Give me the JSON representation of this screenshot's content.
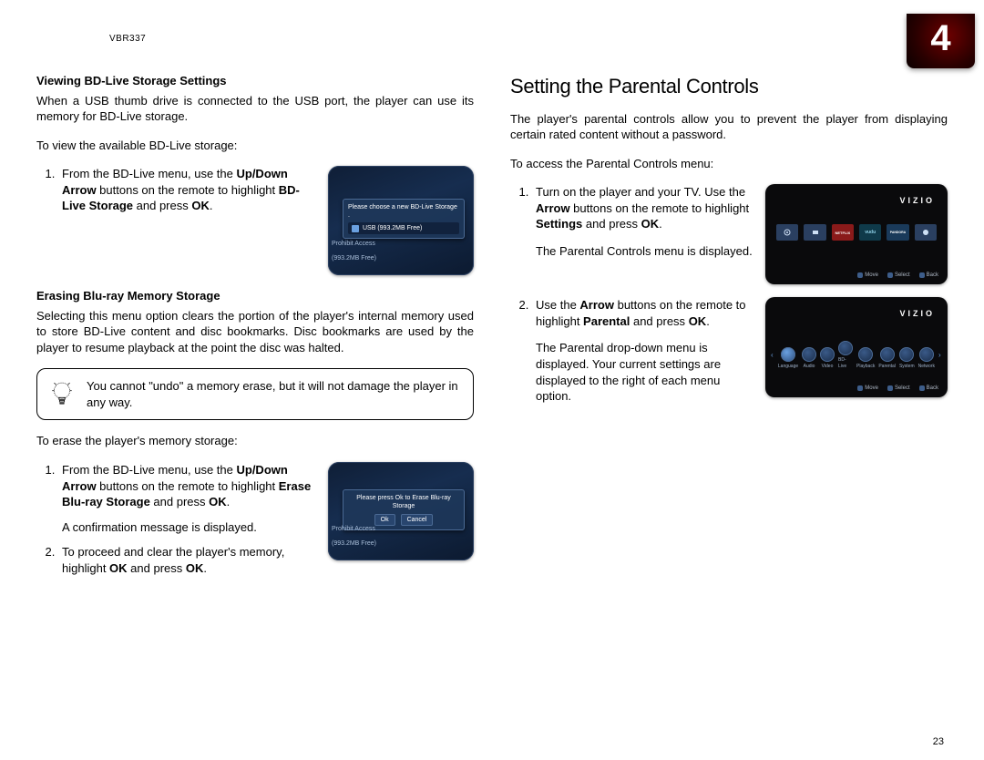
{
  "model": "VBR337",
  "chapter": "4",
  "page_no": "23",
  "left": {
    "sec1_head": "Viewing BD-Live Storage Settings",
    "sec1_body": "When a USB thumb drive is connected to the USB port, the player can use its memory for BD-Live storage.",
    "sec1_lead": "To view the available BD-Live storage:",
    "sec1_step1_pre": "From the BD-Live menu, use the ",
    "sec1_step1_bold1": "Up/Down Arrow",
    "sec1_step1_mid1": " buttons on the remote to highlight ",
    "sec1_step1_bold2": "BD-Live Storage",
    "sec1_step1_mid2": " and press ",
    "sec1_step1_bold3": "OK",
    "sec1_step1_end": ".",
    "thumb1_msg": "Please choose a new BD-Live Storage .",
    "thumb1_usb": "USB (993.2MB Free)",
    "thumb1_side1": "Prohibit Access",
    "thumb1_side2": "(993.2MB Free)",
    "sec2_head": "Erasing Blu-ray Memory Storage",
    "sec2_body": "Selecting this menu option clears the portion of the player's internal memory used to store BD-Live content and disc bookmarks. Disc bookmarks are used by the player to resume playback at the point the disc was halted.",
    "tip": "You cannot \"undo\" a memory erase, but it will not damage the player in any way.",
    "sec2_lead": "To erase the player's memory storage:",
    "sec2_step1_pre": "From the BD-Live menu, use the ",
    "sec2_step1_bold1": "Up/Down Arrow",
    "sec2_step1_mid1": " buttons on the remote to highlight ",
    "sec2_step1_bold2": "Erase Blu-ray Storage",
    "sec2_step1_mid2": " and press ",
    "sec2_step1_bold3": "OK",
    "sec2_step1_end": ".",
    "sec2_step1_after": "A confirmation message is displayed.",
    "sec2_step2_pre": "To proceed and clear the player's memory, highlight ",
    "sec2_step2_bold1": "OK",
    "sec2_step2_mid": " and press ",
    "sec2_step2_bold2": "OK",
    "sec2_step2_end": ".",
    "thumb2_msg": "Please press Ok to Erase Blu-ray Storage",
    "thumb2_ok": "Ok",
    "thumb2_cancel": "Cancel",
    "thumb2_side1": "Prohibit Access",
    "thumb2_side2": "(993.2MB Free)"
  },
  "right": {
    "heading": "Setting the Parental Controls",
    "intro": "The player's parental controls allow you to prevent the player from displaying certain rated content without a password.",
    "lead": "To access the Parental Controls menu:",
    "step1_pre": "Turn on the player and your TV. Use the ",
    "step1_bold1": "Arrow",
    "step1_mid1": " buttons on the remote to highlight ",
    "step1_bold2": "Settings",
    "step1_mid2": " and press ",
    "step1_bold3": "OK",
    "step1_end": ".",
    "step1_after": "The Parental Controls menu is displayed.",
    "step2_pre": "Use the ",
    "step2_bold1": "Arrow",
    "step2_mid1": " buttons on the remote to highlight ",
    "step2_bold2": "Parental",
    "step2_mid2": " and press ",
    "step2_bold3": "OK",
    "step2_end": ".",
    "step2_after": "The Parental drop-down menu is displayed. Your current settings are displayed to the right of each menu option.",
    "vizio_logo": "VIZIO",
    "apps": {
      "netflix": "NETFLIX",
      "vudu": "vudu",
      "pandora": "PANDORA"
    },
    "bottom_move": "Move",
    "bottom_select": "Select",
    "bottom_back": "Back",
    "settings_icons": [
      "Language",
      "Audio",
      "Video",
      "BD-Live",
      "Playback",
      "Parental",
      "System",
      "Network"
    ]
  }
}
